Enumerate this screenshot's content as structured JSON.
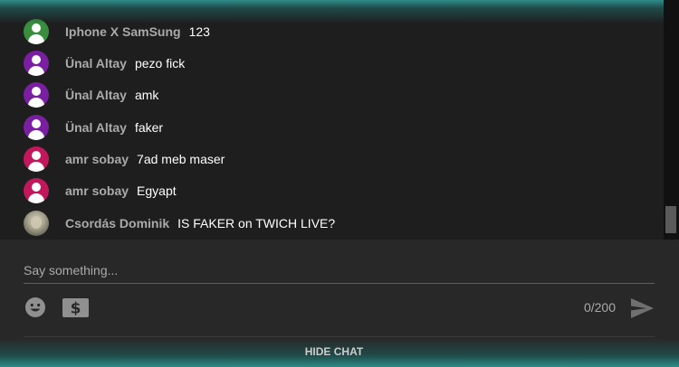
{
  "messages": [
    {
      "author": "Iphone X SamSung",
      "text": "123",
      "avatar_color": "#388e3c"
    },
    {
      "author": "Ünal Altay",
      "text": "pezo fick",
      "avatar_color": "#7b1fa2"
    },
    {
      "author": "Ünal Altay",
      "text": "amk",
      "avatar_color": "#7b1fa2"
    },
    {
      "author": "Ünal Altay",
      "text": "faker",
      "avatar_color": "#7b1fa2"
    },
    {
      "author": "amr sobay",
      "text": "7ad meb maser",
      "avatar_color": "#c2185b"
    },
    {
      "author": "amr sobay",
      "text": "Egyapt",
      "avatar_color": "#c2185b"
    },
    {
      "author": "Csordás Dominik",
      "text": "IS FAKER on TWICH LIVE?",
      "avatar_color": "photo"
    }
  ],
  "input": {
    "placeholder": "Say something...",
    "counter": "0/200"
  },
  "icons": {
    "emoji": "emoji-icon",
    "super_chat": "dollar-icon",
    "send": "send-icon"
  },
  "footer": {
    "hide_chat_label": "HIDE CHAT"
  },
  "colors": {
    "background": "#1e1e1e",
    "input_background": "#282828",
    "glow_accent": "#2e8c88"
  }
}
